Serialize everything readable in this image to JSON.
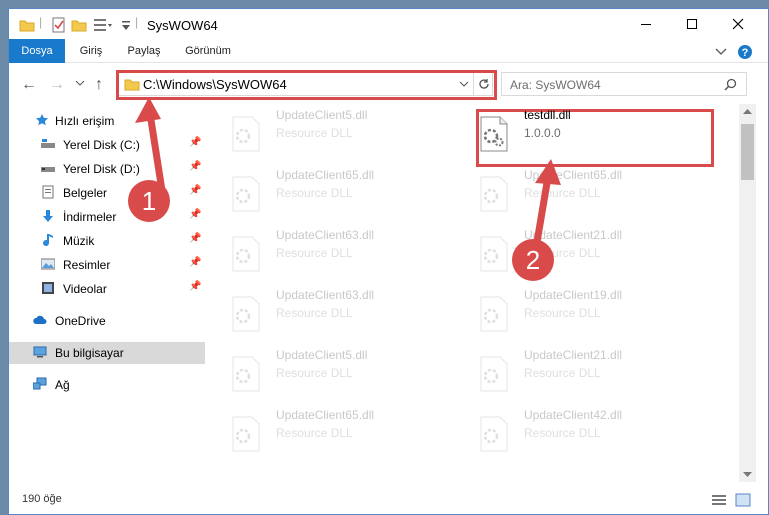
{
  "window": {
    "title": "SysWOW64",
    "minimize_icon": "minimize-icon",
    "maximize_icon": "maximize-icon",
    "close_icon": "close-icon"
  },
  "ribbon": {
    "tabs": [
      "Dosya",
      "Giriş",
      "Paylaş",
      "Görünüm"
    ]
  },
  "address": {
    "path": "C:\\Windows\\SysWOW64",
    "search_placeholder": "Ara: SysWOW64"
  },
  "sidebar": {
    "items": [
      {
        "label": "Hızlı erişim",
        "icon": "star-icon",
        "pinned": false
      },
      {
        "label": "Yerel Disk (C:)",
        "icon": "drive-icon",
        "pinned": true
      },
      {
        "label": "Yerel Disk (D:)",
        "icon": "drive-icon",
        "pinned": true
      },
      {
        "label": "Belgeler",
        "icon": "documents-icon",
        "pinned": true
      },
      {
        "label": "İndirmeler",
        "icon": "download-icon",
        "pinned": true
      },
      {
        "label": "Müzik",
        "icon": "music-icon",
        "pinned": true
      },
      {
        "label": "Resimler",
        "icon": "pictures-icon",
        "pinned": true
      },
      {
        "label": "Videolar",
        "icon": "videos-icon",
        "pinned": true
      },
      {
        "label": "OneDrive",
        "icon": "cloud-icon",
        "pinned": false
      },
      {
        "label": "Bu bilgisayar",
        "icon": "computer-icon",
        "pinned": false
      },
      {
        "label": "Ağ",
        "icon": "network-icon",
        "pinned": false
      }
    ]
  },
  "files": {
    "left": [
      {
        "name": "UpdateClient5.dll",
        "sub": "Resource DLL"
      },
      {
        "name": "UpdateClient65.dll",
        "sub": "Resource DLL"
      },
      {
        "name": "UpdateClient63.dll",
        "sub": "Resource DLL"
      },
      {
        "name": "UpdateClient63.dll",
        "sub": "Resource DLL"
      },
      {
        "name": "UpdateClient5.dll",
        "sub": "Resource DLL"
      },
      {
        "name": "UpdateClient65.dll",
        "sub": "Resource DLL"
      }
    ],
    "right": [
      {
        "name": "testdll.dll",
        "sub": "1.0.0.0"
      },
      {
        "name": "UpdateClient65.dll",
        "sub": "Resource DLL"
      },
      {
        "name": "UpdateClient21.dll",
        "sub": "Resource DLL"
      },
      {
        "name": "UpdateClient19.dll",
        "sub": "Resource DLL"
      },
      {
        "name": "UpdateClient21.dll",
        "sub": "Resource DLL"
      },
      {
        "name": "UpdateClient42.dll",
        "sub": "Resource DLL"
      }
    ]
  },
  "status": {
    "count": "190 öğe"
  },
  "annotations": {
    "step1": "1",
    "step2": "2",
    "color": "#d94b4b"
  }
}
